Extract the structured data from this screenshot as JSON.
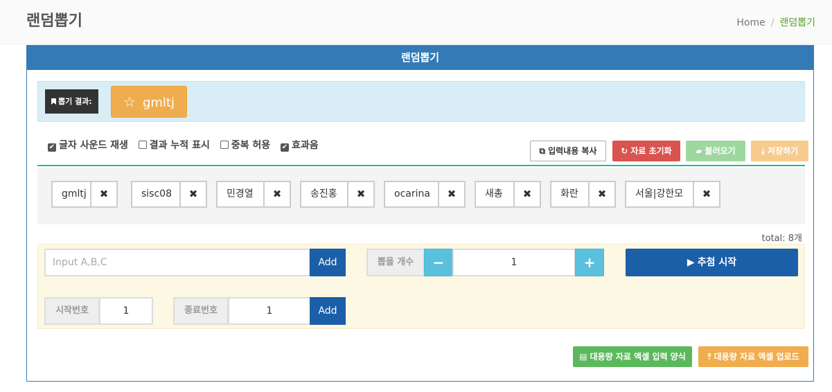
{
  "header": {
    "title": "랜덤뽑기",
    "breadcrumb": [
      "Home",
      "랜덤뽑기"
    ]
  },
  "panel": {
    "title": "랜덤뽑기"
  },
  "result": {
    "label": "뽑기 결과:",
    "value": "gmltj"
  },
  "options": [
    {
      "label": "글자 사운드 재생",
      "checked": true
    },
    {
      "label": "결과 누적 표시",
      "checked": false
    },
    {
      "label": "중복 허용",
      "checked": false
    },
    {
      "label": "효과음",
      "checked": true
    }
  ],
  "actions": {
    "copy": "입력내용 복사",
    "reset": "자료 초기화",
    "load": "불러오기",
    "save": "저장하기"
  },
  "items": [
    "gmltj",
    "sisc08",
    "민경열",
    "송진홍",
    "ocarina",
    "새총",
    "화란",
    "서울|강한모"
  ],
  "total": "total: 8개",
  "form": {
    "input_placeholder": "Input A,B,C",
    "add_label": "Add",
    "count_label": "뽑을 개수",
    "count_value": "1",
    "start_label": "추첨 시작",
    "start_num_label": "시작번호",
    "start_num_value": "1",
    "end_num_label": "종료번호",
    "end_num_value": "1",
    "add2_label": "Add"
  },
  "bulk": {
    "form_label": "대용량 자료 엑셀 입력 양식",
    "upload_label": "대용량 자료 엑셀 업로드"
  }
}
